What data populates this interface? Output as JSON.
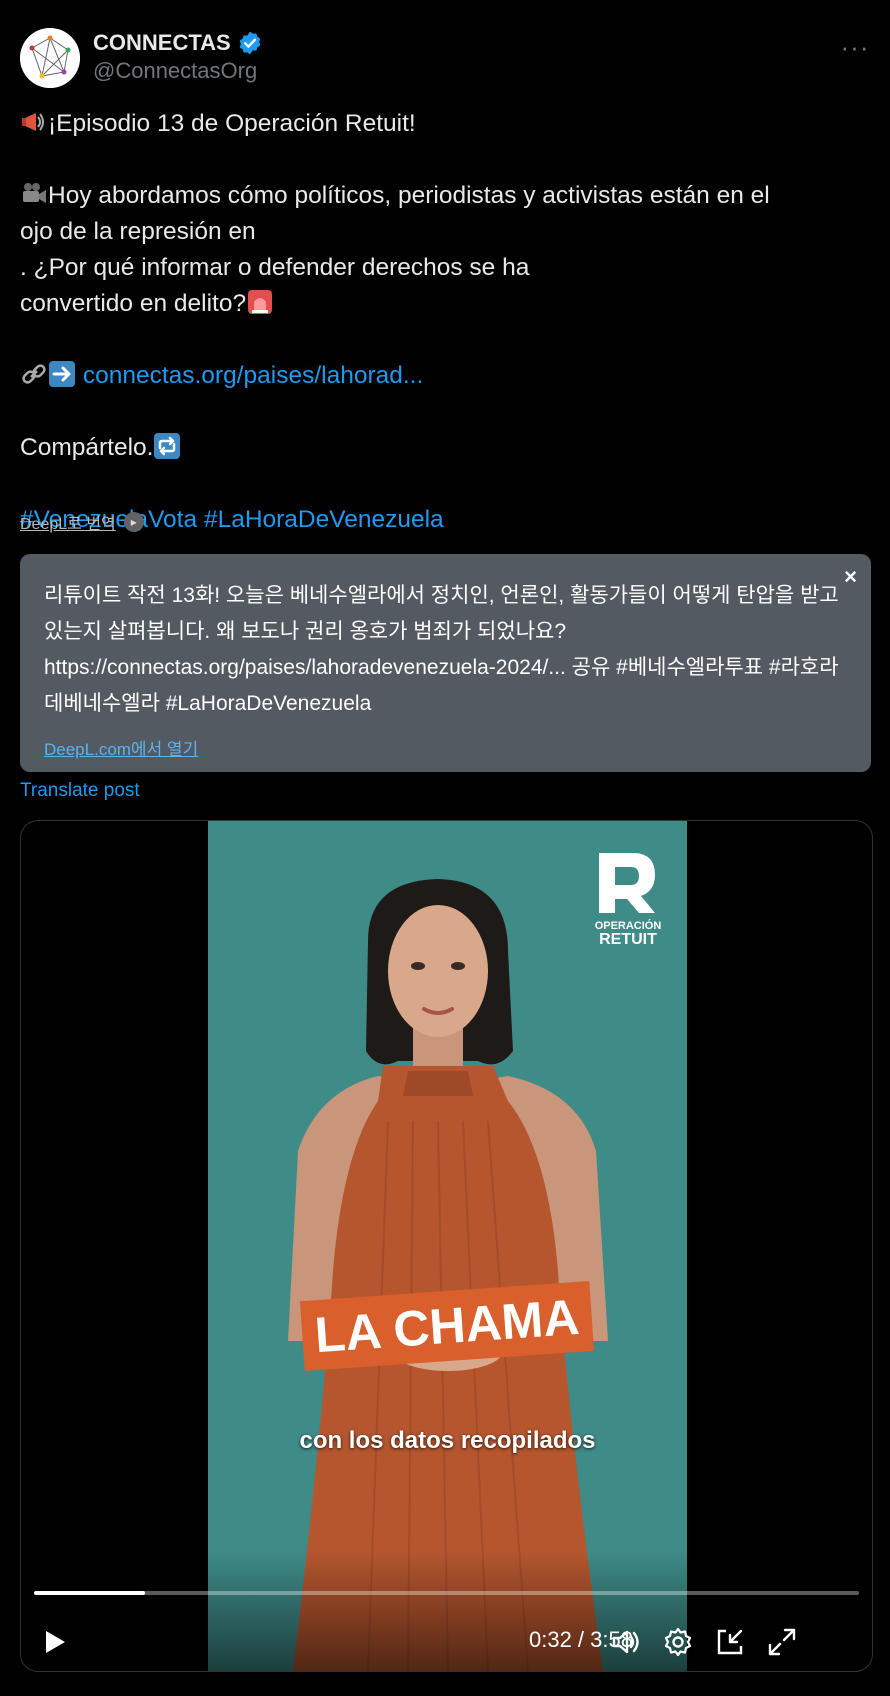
{
  "author": {
    "name": "CONNECTAS",
    "handle": "@ConnectasOrg",
    "verified": true
  },
  "tweet": {
    "line1": "¡Episodio 13 de Operación Retuit!",
    "line2a": "Hoy abordamos cómo políticos, periodistas y activistas están en el",
    "line2b_pre": "ojo de la represión en ",
    "line2b_post": ". ¿Por qué informar o defender derechos se ha",
    "line2c": "convertido en delito?",
    "link": "connectas.org/paises/lahorad...",
    "share": "Compártelo.",
    "hashtag1": "#VenezuelaVota",
    "hashtag2": "#LaHoraDeVenezuela"
  },
  "deepl": {
    "label": "DeepL로 번역",
    "translation": "리튜이트 작전 13화! 오늘은 베네수엘라에서 정치인, 언론인, 활동가들이 어떻게 탄압을 받고 있는지 살펴봅니다. 왜 보도나 권리 옹호가 범죄가 되었나요? https://connectas.org/paises/lahoradevenezuela-2024/... 공유 #베네수엘라투표 #라호라데베네수엘라 #LaHoraDeVenezuela",
    "open_link": "DeepL.com에서 열기",
    "close": "×"
  },
  "translate_post": "Translate post",
  "video": {
    "name_tag": "LA CHAMA",
    "caption": "con los datos recopilados",
    "logo_line1": "OPERACIÓN",
    "logo_line2": "RETUIT",
    "time": "0:32 / 3:58",
    "progress": 0.134
  },
  "icons": {
    "megaphone": "megaphone-icon",
    "camera": "movie-camera-icon",
    "flag": "venezuela-flag-icon",
    "siren": "siren-icon",
    "link": "link-icon",
    "arrow": "right-arrow-icon",
    "repeat": "repeat-icon"
  },
  "colors": {
    "accent": "#1d9bf0",
    "verified": "#1d9bf0",
    "video_bg": "#3e8b88",
    "name_tag": "#d9602c"
  }
}
